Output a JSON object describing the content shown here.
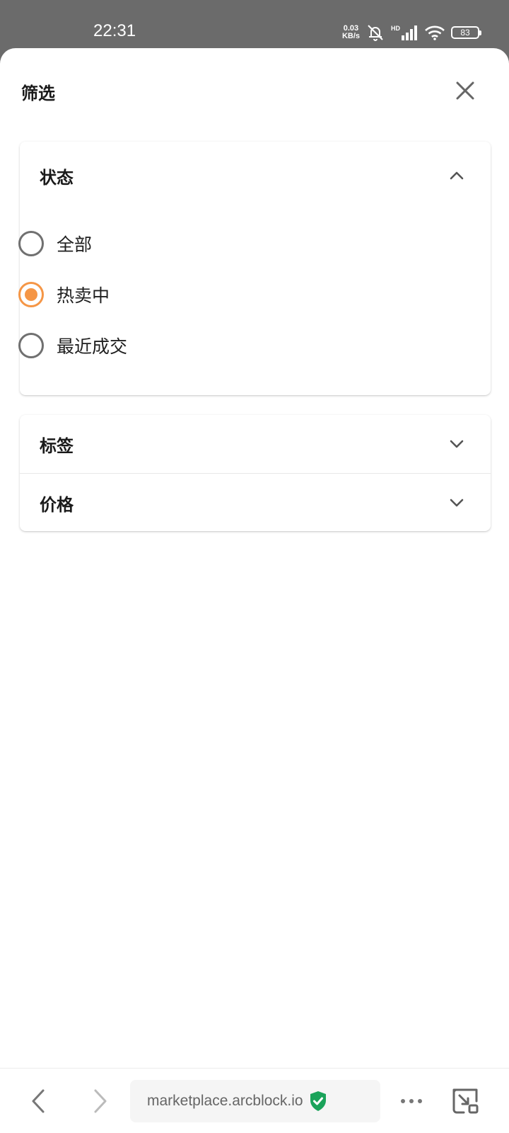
{
  "status_bar": {
    "time": "22:31",
    "net_speed_value": "0.03",
    "net_speed_unit": "KB/s",
    "network_badge": "HD",
    "battery": "83",
    "icons": [
      "mute-bell-icon",
      "signal-icon",
      "wifi-icon",
      "battery-icon"
    ]
  },
  "sheet": {
    "title": "筛选",
    "close_icon": "close-icon"
  },
  "filters": {
    "status": {
      "title": "状态",
      "expanded": true,
      "options": [
        {
          "label": "全部",
          "checked": false
        },
        {
          "label": "热卖中",
          "checked": true
        },
        {
          "label": "最近成交",
          "checked": false
        }
      ]
    },
    "tags": {
      "title": "标签",
      "expanded": false
    },
    "price": {
      "title": "价格",
      "expanded": false
    }
  },
  "browser": {
    "url": "marketplace.arcblock.io",
    "secure": true,
    "icons": [
      "back-icon",
      "forward-icon",
      "shield-check-icon",
      "more-icon",
      "minimize-window-icon"
    ]
  },
  "colors": {
    "accent": "#f59646",
    "status_bar_bg": "#6b6b6b",
    "secure_green": "#1aa35a"
  }
}
